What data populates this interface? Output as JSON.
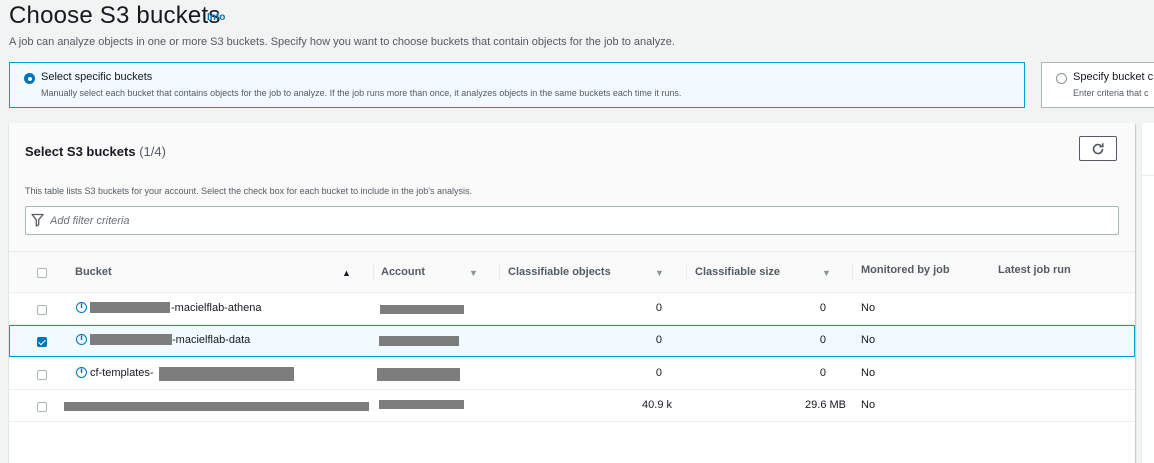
{
  "header": {
    "title": "Choose S3 buckets",
    "info_label": "Info",
    "description": "A job can analyze objects in one or more S3 buckets. Specify how you want to choose buckets that contain objects for the job to analyze."
  },
  "selection_tiles": [
    {
      "title": "Select specific buckets",
      "description": "Manually select each bucket that contains objects for the job to analyze. If the job runs more than once, it analyzes objects in the same buckets each time it runs.",
      "selected": true
    },
    {
      "title": "Specify bucket c",
      "description": "Enter criteria that c",
      "selected": false
    }
  ],
  "table_panel": {
    "title": "Select S3 buckets",
    "count": "(1/4)",
    "description": "This table lists S3 buckets for your account. Select the check box for each bucket to include in the job's analysis.",
    "filter_placeholder": "Add filter criteria",
    "columns": {
      "bucket": "Bucket",
      "account": "Account",
      "classifiable_objects": "Classifiable objects",
      "classifiable_size": "Classifiable size",
      "monitored_by_job": "Monitored by job",
      "latest_job_run": "Latest job run"
    },
    "rows": [
      {
        "bucket_suffix": "-macielflab-athena",
        "classifiable_objects": "0",
        "classifiable_size": "0",
        "monitored": "No",
        "checked": false
      },
      {
        "bucket_suffix": "-macielflab-data",
        "classifiable_objects": "0",
        "classifiable_size": "0",
        "monitored": "No",
        "checked": true
      },
      {
        "bucket_prefix": "cf-templates-",
        "classifiable_objects": "0",
        "classifiable_size": "0",
        "monitored": "No",
        "checked": false
      },
      {
        "bucket_suffix": "",
        "classifiable_objects": "40.9 k",
        "classifiable_size": "29.6 MB",
        "monitored": "No",
        "checked": false
      }
    ]
  },
  "colors": {
    "accent": "#0073bb",
    "selected_border": "#00a1c9",
    "selected_bg": "#f1faff",
    "redaction": "#7d7d7d"
  },
  "icons": {
    "refresh": "refresh-icon",
    "filter": "filter-funnel-icon",
    "sort_active": "sort-ascending-icon",
    "sort_inactive": "sort-descending-icon",
    "bucket_info": "info-circle-icon"
  }
}
